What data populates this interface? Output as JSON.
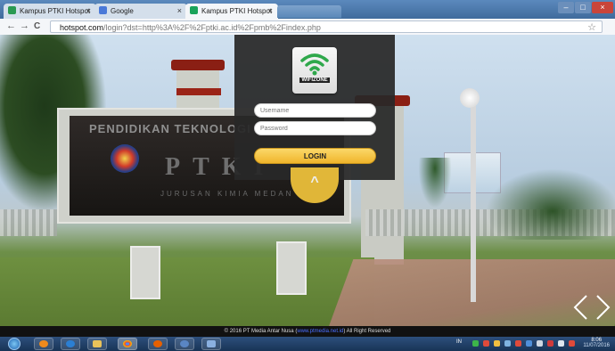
{
  "browser": {
    "tabs": [
      {
        "label": "Kampus PTKI Hotspot",
        "active": false
      },
      {
        "label": "Google",
        "active": false
      },
      {
        "label": "Kampus PTKI Hotspot",
        "active": true
      }
    ],
    "url_host": "hotspot.com",
    "url_path": "/login?dst=http%3A%2F%2Fptki.ac.id%2Fpmb%2Findex.php",
    "back_glyph": "←",
    "forward_glyph": "→",
    "reload_glyph": "C",
    "star_glyph": "☆"
  },
  "photo": {
    "sign_line1": "PENDIDIKAN TEKNOLOGI KIMIA",
    "sign_big": "PTKI",
    "sign_sub": "JURUSAN KIMIA MEDAN"
  },
  "login": {
    "logo_text": "WIFIZONE",
    "username_placeholder": "Username",
    "password_placeholder": "Password",
    "login_label": "LOGIN",
    "collapse_glyph": "^"
  },
  "footer": {
    "prefix": "© 2016 PT Media Antar Nusa (",
    "link": "www.ptmedia.net.id",
    "suffix": ") All Right Reserved"
  },
  "taskbar": {
    "language": "IN",
    "clock_time": "8:06",
    "clock_date": "11/07/2016",
    "colors": {
      "chrome": "#1f64b0",
      "firefox": "#e66000",
      "ie": "#2b7fd3"
    }
  },
  "icons": {
    "wifi": "wifi-signal-icon",
    "prev": "arrow-left-icon",
    "next": "arrow-right-icon"
  }
}
